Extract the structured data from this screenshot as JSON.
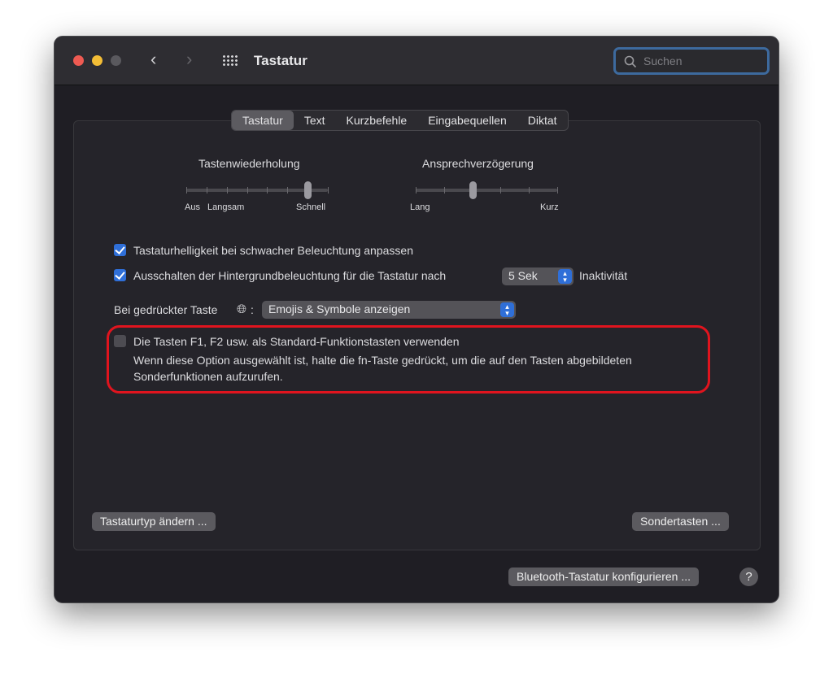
{
  "window": {
    "title": "Tastatur",
    "search_placeholder": "Suchen"
  },
  "tabs": [
    {
      "label": "Tastatur",
      "selected": true
    },
    {
      "label": "Text"
    },
    {
      "label": "Kurzbefehle"
    },
    {
      "label": "Eingabequellen"
    },
    {
      "label": "Diktat"
    }
  ],
  "key_repeat": {
    "label": "Tastenwiederholung",
    "min_label1": "Aus",
    "min_label2": "Langsam",
    "max_label": "Schnell",
    "value_step": 6,
    "steps": 8
  },
  "delay": {
    "label": "Ansprechverzögerung",
    "min_label": "Lang",
    "max_label": "Kurz",
    "value_step": 2,
    "steps": 6
  },
  "options": {
    "brightness": {
      "label": "Tastaturhelligkeit bei schwacher Beleuchtung anpassen",
      "checked": true
    },
    "backlight_off": {
      "label": "Ausschalten der Hintergrundbeleuchtung für die Tastatur nach",
      "checked": true,
      "value": "5 Sek",
      "suffix": "Inaktivität"
    },
    "globe": {
      "label": "Bei gedrückter Taste",
      "icon": "globe-icon",
      "colon": ":",
      "value": "Emojis & Symbole anzeigen"
    },
    "fn_keys": {
      "label": "Die Tasten F1, F2 usw. als Standard-Funktionstasten verwenden",
      "checked": false,
      "description_line1": "Wenn diese Option ausgewählt ist, halte die fn-Taste gedrückt, um die auf den Tasten abgebildeten",
      "description_line2": "Sonderfunktionen aufzurufen."
    }
  },
  "buttons": {
    "change_type": "Tastaturtyp ändern ...",
    "modifier": "Sondertasten ...",
    "bluetooth": "Bluetooth-Tastatur konfigurieren ...",
    "help": "?"
  },
  "colors": {
    "accent": "#2f6fd8",
    "highlight": "#e0141e"
  }
}
